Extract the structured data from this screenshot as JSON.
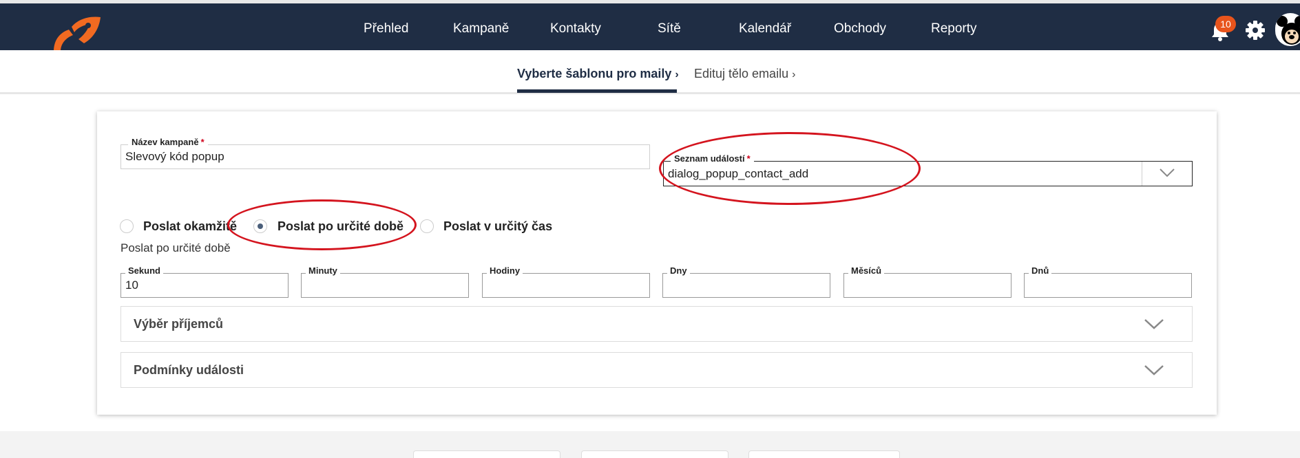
{
  "nav": {
    "items": [
      "Přehled",
      "Kampaně",
      "Kontakty",
      "Sítě",
      "Kalendář",
      "Obchody",
      "Reporty"
    ],
    "notification_count": "10",
    "icons": {
      "logo": "rocket-logo",
      "bell": "bell-icon",
      "gear": "gear-icon",
      "avatar": "mickey-avatar"
    },
    "colors": {
      "bar": "#1f2d44",
      "badge": "#e8541c",
      "logo": "#f26a21"
    }
  },
  "steps": {
    "active": "Vyberte šablonu pro maily",
    "next": "Edituj tělo emailu"
  },
  "form": {
    "campaign_name": {
      "label": "Název kampaně",
      "value": "Slevový kód popup"
    },
    "event_list": {
      "label": "Seznam událostí",
      "value": "dialog_popup_contact_add"
    },
    "required_mark": "*",
    "send_options": [
      {
        "label": "Poslat okamžitě",
        "selected": false
      },
      {
        "label": "Poslat po určité době",
        "selected": true
      },
      {
        "label": "Poslat v určitý čas",
        "selected": false
      }
    ],
    "delay_title": "Poslat po určité době",
    "delay_fields": [
      {
        "label": "Sekund",
        "value": "10"
      },
      {
        "label": "Minuty",
        "value": ""
      },
      {
        "label": "Hodiny",
        "value": ""
      },
      {
        "label": "Dny",
        "value": ""
      },
      {
        "label": "Měsíců",
        "value": ""
      },
      {
        "label": "Dnů",
        "value": ""
      }
    ],
    "sections": [
      "Výběr příjemců",
      "Podmínky události"
    ]
  },
  "annotation_color": "#d4141e"
}
